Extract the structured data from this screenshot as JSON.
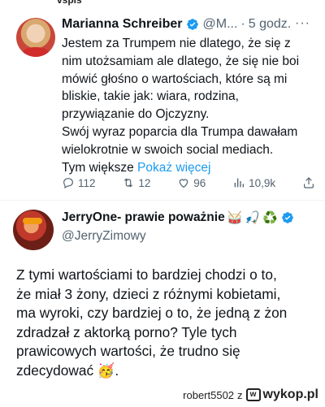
{
  "tweet1": {
    "author_name": "Marianna Schreiber",
    "handle": "@M...",
    "time": "5 godz.",
    "text_lines": [
      "Jestem za Trumpem nie dlatego, że się z",
      "nim utożsamiam ale dlatego, że się nie boi",
      "mówić głośno o wartościach, które są mi",
      "bliskie, takie jak: wiara, rodzina,",
      "przywiązanie do Ojczyzny.",
      "Swój wyraz poparcia dla Trumpa dawałam",
      "wielokrotnie w swoich social mediach."
    ],
    "last_line_prefix": "Tym większe",
    "show_more": "Pokaż więcej",
    "replies": "112",
    "reposts": "12",
    "likes": "96",
    "views": "10,9k"
  },
  "tweet2": {
    "author_name": "JerryOne- prawie poważnie",
    "handle": "@JerryZimowy",
    "name_emojis": [
      "🥁",
      "🎣",
      "♻️"
    ],
    "text_lines": [
      "Z tymi wartościami to bardziej chodzi o to,",
      "że miał 3 żony, dzieci z różnymi kobietami,",
      "ma wyroki, czy bardziej o to, że jedną z żon",
      "zdradzał z aktorką porno? Tyle tych",
      "prawicowych wartości, że trudno się",
      "zdecydować 🥳."
    ]
  },
  "footer": {
    "credit": "robert5502",
    "separator": "z",
    "site": "wykop.pl"
  },
  "colors": {
    "accent": "#1d9bf0",
    "muted": "#536471",
    "text": "#0f1419"
  }
}
